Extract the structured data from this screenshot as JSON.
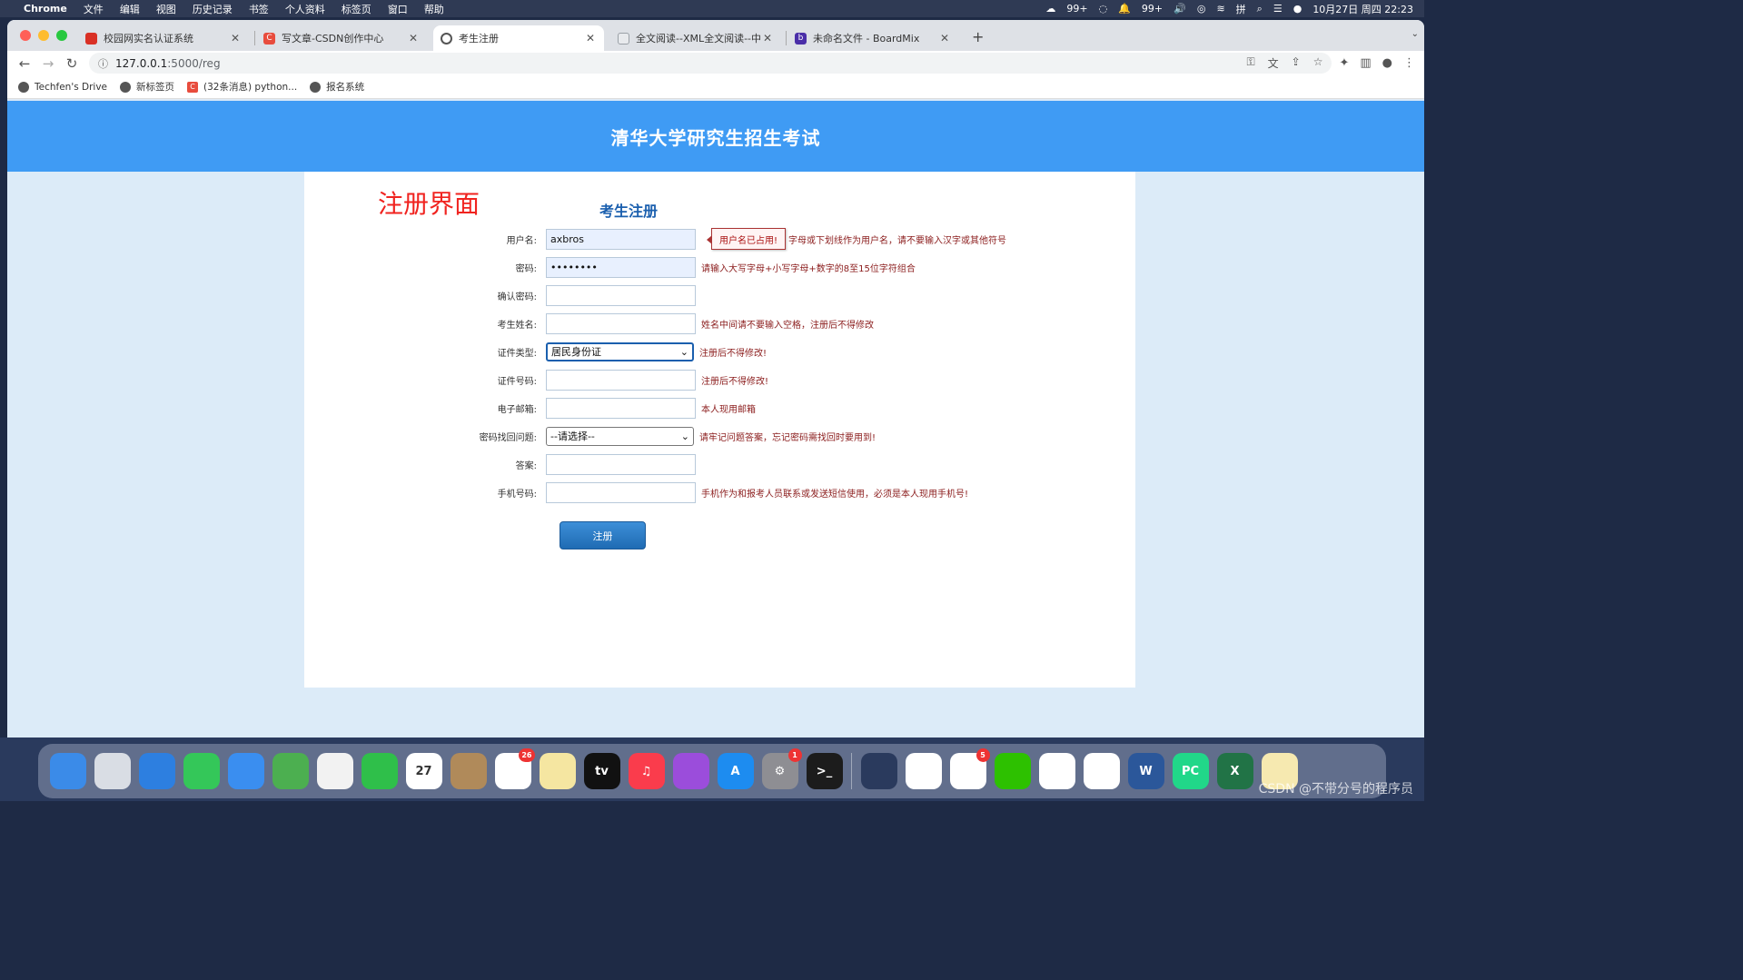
{
  "menubar": {
    "app": "Chrome",
    "items": [
      "文件",
      "编辑",
      "视图",
      "历史记录",
      "书签",
      "个人资料",
      "标签页",
      "窗口",
      "帮助"
    ],
    "status": [
      "99+",
      "99+",
      "10月27日 周四 22:23"
    ]
  },
  "tabs": [
    {
      "title": "校园网实名认证系统",
      "color": "#d93025"
    },
    {
      "title": "写文章-CSDN创作中心",
      "color": "#e84c3d"
    },
    {
      "title": "考生注册",
      "color": "#555555"
    },
    {
      "title": "全文阅读--XML全文阅读--中国知",
      "color": "#9aa0a6"
    },
    {
      "title": "未命名文件 - BoardMix",
      "color": "#4a2ea8"
    }
  ],
  "address": {
    "host": "127.0.0.1",
    "path": ":5000/reg"
  },
  "bookmarks": [
    "Techfen's Drive",
    "新标签页",
    "(32条消息) python...",
    "报名系统"
  ],
  "banner": {
    "title": "清华大学研究生招生考试"
  },
  "overlay_title": "注册界面",
  "form": {
    "title": "考生注册",
    "tooltip": "用户名已占用!",
    "fields": [
      {
        "label": "用户名:",
        "value": "axbros",
        "hint": "、字母或下划线作为用户名，请不要输入汉字或其他符号"
      },
      {
        "label": "密码:",
        "value": "••••••••",
        "hint": "请输入大写字母+小写字母+数字的8至15位字符组合"
      },
      {
        "label": "确认密码:",
        "value": "",
        "hint": ""
      },
      {
        "label": "考生姓名:",
        "value": "",
        "hint": "姓名中间请不要输入空格，注册后不得修改"
      },
      {
        "label": "证件类型:",
        "value": "居民身份证",
        "hint": "注册后不得修改!"
      },
      {
        "label": "证件号码:",
        "value": "",
        "hint": "注册后不得修改!"
      },
      {
        "label": "电子邮箱:",
        "value": "",
        "hint": "本人现用邮箱"
      },
      {
        "label": "密码找回问题:",
        "value": "--请选择--",
        "hint": "请牢记问题答案，忘记密码需找回时要用到!"
      },
      {
        "label": "答案:",
        "value": "",
        "hint": ""
      },
      {
        "label": "手机号码:",
        "value": "",
        "hint": "手机作为和报考人员联系或发送短信使用，必须是本人现用手机号!"
      }
    ],
    "submit": "注册"
  },
  "dock": {
    "items": [
      {
        "name": "finder",
        "color": "#3b8be8",
        "label": ""
      },
      {
        "name": "launchpad",
        "color": "#d9dde4",
        "label": ""
      },
      {
        "name": "safari",
        "color": "#2d7fe0",
        "label": ""
      },
      {
        "name": "messages",
        "color": "#34c759",
        "label": ""
      },
      {
        "name": "mail",
        "color": "#3a8ef0",
        "label": ""
      },
      {
        "name": "maps",
        "color": "#4caf50",
        "label": ""
      },
      {
        "name": "photos",
        "color": "#f2f2f2",
        "label": ""
      },
      {
        "name": "facetime",
        "color": "#2fbf4a",
        "label": ""
      },
      {
        "name": "calendar",
        "color": "#ffffff",
        "label": "27"
      },
      {
        "name": "contacts",
        "color": "#b08a5a",
        "label": ""
      },
      {
        "name": "reminders",
        "color": "#ffffff",
        "label": "",
        "badge": "26"
      },
      {
        "name": "notes",
        "color": "#f5e6a1",
        "label": ""
      },
      {
        "name": "apple-tv",
        "color": "#111111",
        "label": "tv"
      },
      {
        "name": "music",
        "color": "#fa3c4c",
        "label": "♫"
      },
      {
        "name": "podcasts",
        "color": "#9b4ddb",
        "label": ""
      },
      {
        "name": "app-store",
        "color": "#1d8cf0",
        "label": "A"
      },
      {
        "name": "system-settings",
        "color": "#8e8e93",
        "label": "⚙",
        "badge": "1"
      },
      {
        "name": "terminal",
        "color": "#1c1c1c",
        "label": ">_"
      },
      {
        "name": "qq",
        "color": "#2a3a5d",
        "label": ""
      },
      {
        "name": "lark",
        "color": "#ffffff",
        "label": ""
      },
      {
        "name": "app-store-cn",
        "color": "#ffffff",
        "label": "",
        "badge": "5"
      },
      {
        "name": "wechat",
        "color": "#2dc100",
        "label": ""
      },
      {
        "name": "chrome",
        "color": "#ffffff",
        "label": ""
      },
      {
        "name": "qq-browser",
        "color": "#ffffff",
        "label": ""
      },
      {
        "name": "word",
        "color": "#2b579a",
        "label": "W"
      },
      {
        "name": "pycharm",
        "color": "#21d789",
        "label": "PC"
      },
      {
        "name": "excel",
        "color": "#217346",
        "label": "X"
      },
      {
        "name": "aura",
        "color": "#f6e9b0",
        "label": ""
      }
    ]
  },
  "watermark": "CSDN @不带分号的程序员"
}
